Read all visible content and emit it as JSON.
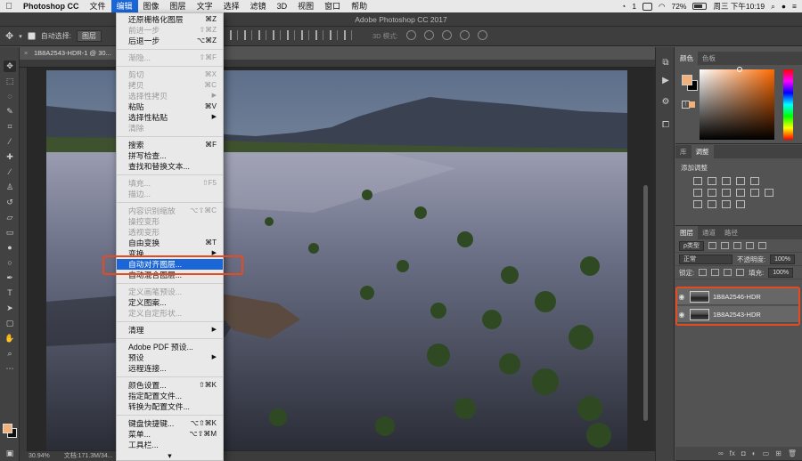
{
  "menubar": {
    "apple_icon": "apple-logo",
    "items": [
      "Photoshop CC",
      "文件",
      "编辑",
      "图像",
      "图层",
      "文字",
      "选择",
      "滤镜",
      "3D",
      "视图",
      "窗口",
      "帮助"
    ],
    "active_item": "编辑",
    "status": {
      "notifications": "1",
      "battery": "72%",
      "clock": "周三 下午10:19"
    }
  },
  "window": {
    "title": "Adobe Photoshop CC 2017",
    "doc_tab": "1B8A2543-HDR-1 @ 30..."
  },
  "options_bar": {
    "auto_select_label": "自动选择:",
    "auto_select_target": "图层",
    "mode_3d_label": "3D 模式:"
  },
  "edit_menu": {
    "groups": [
      [
        {
          "label": "还原栅格化图层",
          "shortcut": "⌘Z",
          "disabled": false
        },
        {
          "label": "前进一步",
          "shortcut": "⇧⌘Z",
          "disabled": true
        },
        {
          "label": "后退一步",
          "shortcut": "⌥⌘Z",
          "disabled": false
        }
      ],
      [
        {
          "label": "渐隐...",
          "shortcut": "⇧⌘F",
          "disabled": true
        }
      ],
      [
        {
          "label": "剪切",
          "shortcut": "⌘X",
          "disabled": true
        },
        {
          "label": "拷贝",
          "shortcut": "⌘C",
          "disabled": true
        },
        {
          "label": "选择性拷贝",
          "arrow": true,
          "disabled": true
        },
        {
          "label": "粘贴",
          "shortcut": "⌘V",
          "disabled": false
        },
        {
          "label": "选择性粘贴",
          "arrow": true,
          "disabled": false
        },
        {
          "label": "清除",
          "disabled": true
        }
      ],
      [
        {
          "label": "搜索",
          "shortcut": "⌘F",
          "disabled": false
        },
        {
          "label": "拼写检查...",
          "disabled": false
        },
        {
          "label": "查找和替换文本...",
          "disabled": false
        }
      ],
      [
        {
          "label": "填充...",
          "shortcut": "⇧F5",
          "disabled": true
        },
        {
          "label": "描边...",
          "disabled": true
        }
      ],
      [
        {
          "label": "内容识别缩放",
          "shortcut": "⌥⇧⌘C",
          "disabled": true
        },
        {
          "label": "操控变形",
          "disabled": true
        },
        {
          "label": "透视变形",
          "disabled": true
        },
        {
          "label": "自由变换",
          "shortcut": "⌘T",
          "disabled": false
        },
        {
          "label": "变换",
          "arrow": true,
          "disabled": false
        },
        {
          "label": "自动对齐图层...",
          "disabled": false,
          "highlighted": true
        },
        {
          "label": "自动混合图层...",
          "disabled": false
        }
      ],
      [
        {
          "label": "定义画笔预设...",
          "disabled": true
        },
        {
          "label": "定义图案...",
          "disabled": false
        },
        {
          "label": "定义自定形状...",
          "disabled": true
        }
      ],
      [
        {
          "label": "清理",
          "arrow": true,
          "disabled": false
        }
      ],
      [
        {
          "label": "Adobe PDF 预设...",
          "disabled": false
        },
        {
          "label": "预设",
          "arrow": true,
          "disabled": false
        },
        {
          "label": "远程连接...",
          "disabled": false
        }
      ],
      [
        {
          "label": "颜色设置...",
          "shortcut": "⇧⌘K",
          "disabled": false
        },
        {
          "label": "指定配置文件...",
          "disabled": false
        },
        {
          "label": "转换为配置文件...",
          "disabled": false
        }
      ],
      [
        {
          "label": "键盘快捷键...",
          "shortcut": "⌥⇧⌘K",
          "disabled": false
        },
        {
          "label": "菜单...",
          "shortcut": "⌥⇧⌘M",
          "disabled": false
        },
        {
          "label": "工具栏...",
          "disabled": false
        }
      ]
    ],
    "more_arrow": "▾"
  },
  "panels": {
    "color": {
      "tabs": [
        "颜色",
        "色板"
      ],
      "foreground": "#f2b07a",
      "background": "#000000"
    },
    "adjust": {
      "tabs": [
        "库",
        "调整"
      ],
      "label": "添加调整"
    },
    "layers": {
      "tabs": [
        "图层",
        "通道",
        "路径"
      ],
      "kind_filter": "ρ类型",
      "blend_mode": "正常",
      "opacity_label": "不透明度:",
      "opacity": "100%",
      "lock_label": "锁定:",
      "fill_label": "填充:",
      "fill": "100%",
      "layers": [
        {
          "name": "1B8A2546-HDR"
        },
        {
          "name": "1B8A2543-HDR"
        }
      ]
    }
  },
  "status": {
    "zoom": "30.94%",
    "doc": "文档:171.3M/34..."
  },
  "colors": {
    "highlight": "#e84a1f",
    "menu_selected": "#1a66d6"
  }
}
